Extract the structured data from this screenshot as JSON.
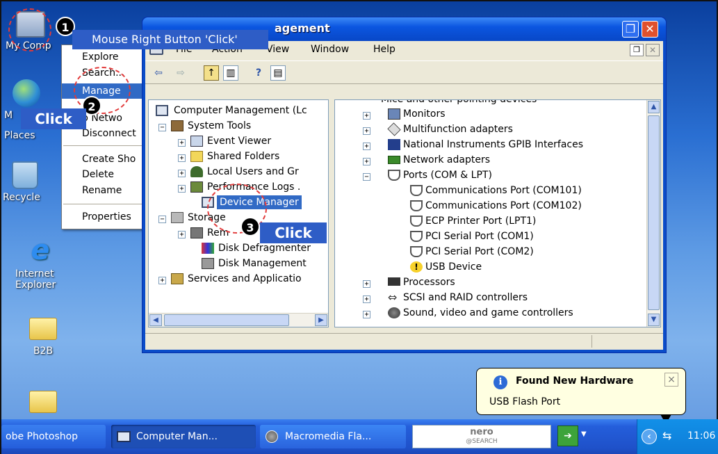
{
  "desktop": {
    "icons": [
      {
        "label": "My Comp"
      },
      {
        "label": "M",
        "label2": "Places"
      },
      {
        "label": "Recycle"
      },
      {
        "label": "Internet",
        "label2": "Explorer"
      },
      {
        "label": "B2B"
      },
      {
        "label": ""
      }
    ]
  },
  "context_menu": {
    "items": [
      "Explore",
      "Search...",
      "Manage",
      "p Netwo",
      "Disconnect",
      "Create Sho",
      "Delete",
      "Rename",
      "Properties"
    ],
    "selected": "Manage"
  },
  "annotations": {
    "step1_num": "1",
    "step1_text": "Mouse Right Button 'Click'",
    "step2_num": "2",
    "step2_text": "Click",
    "step3_num": "3",
    "step3_text": "Click"
  },
  "window": {
    "title": "agement",
    "menus": [
      "File",
      "Action",
      "View",
      "Window",
      "Help"
    ],
    "tree": {
      "root": "Computer Management (Lc",
      "system_tools": "System Tools",
      "event_viewer": "Event Viewer",
      "shared_folders": "Shared Folders",
      "local_users": "Local Users and Gr",
      "perf_logs": "Performance Logs .",
      "device_manager": "Device Manager",
      "storage": "Storage",
      "removable": "Rem",
      "defrag": "Disk Defragmenter",
      "disk_mgmt": "Disk Management",
      "services": "Services and Applicatio"
    },
    "devices": {
      "partial_top": "Mice and other pointing devices",
      "monitors": "Monitors",
      "multifunction": "Multifunction adapters",
      "ni_gpib": "National Instruments GPIB Interfaces",
      "network": "Network adapters",
      "ports": "Ports (COM & LPT)",
      "com101": "Communications Port (COM101)",
      "com102": "Communications Port (COM102)",
      "lpt1": "ECP Printer Port (LPT1)",
      "com1": "PCI Serial Port (COM1)",
      "com2": "PCI Serial Port (COM2)",
      "usb": "USB Device",
      "processors": "Processors",
      "scsi": "SCSI and RAID controllers",
      "sound": "Sound, video and game controllers"
    }
  },
  "taskbar": {
    "tasks": [
      "obe Photoshop",
      "Computer Man...",
      "Macromedia Fla..."
    ],
    "search_logo": "nero",
    "search_logo_sub": "@SEARCH",
    "clock": "11:06"
  },
  "balloon": {
    "title": "Found New Hardware",
    "body": "USB Flash Port",
    "close": "×"
  },
  "colors": {
    "selection": "#316ac5",
    "callout": "#2e5dc6",
    "annotation_circle": "#e23b3b"
  }
}
